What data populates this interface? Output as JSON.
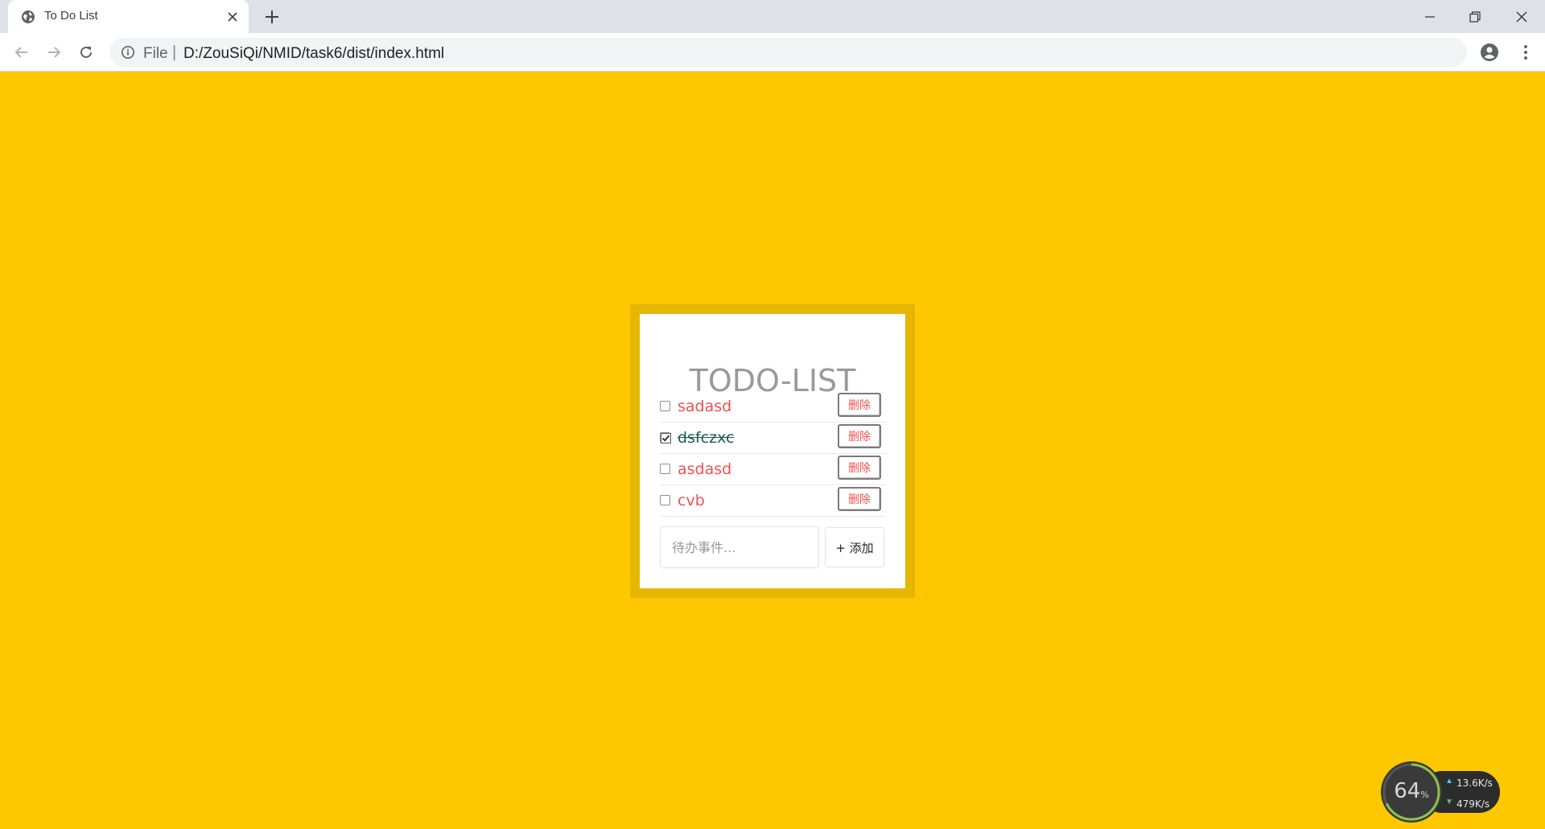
{
  "browser": {
    "tab_title": "To Do List",
    "url_scheme_label": "File",
    "url_separator": "|",
    "url": "D:/ZouSiQi/NMID/task6/dist/index.html"
  },
  "todo": {
    "title": "TODO-LIST",
    "items": [
      {
        "text": "sadasd",
        "done": false,
        "delete_label": "删除"
      },
      {
        "text": "dsfczxc",
        "done": true,
        "delete_label": "删除"
      },
      {
        "text": "asdasd",
        "done": false,
        "delete_label": "删除"
      },
      {
        "text": "cvb",
        "done": false,
        "delete_label": "删除"
      }
    ],
    "input_placeholder": "待办事件...",
    "input_value": "",
    "add_label": "+ 添加"
  },
  "speed_widget": {
    "percent": "64",
    "percent_unit": "%",
    "upload": "13.6K/s",
    "download": "479K/s"
  },
  "colors": {
    "page_background": "#fec700",
    "card_border": "#e6b700",
    "item_text": "#f05050",
    "done_text": "#1e5a57",
    "title_text": "#9a9a9a"
  }
}
